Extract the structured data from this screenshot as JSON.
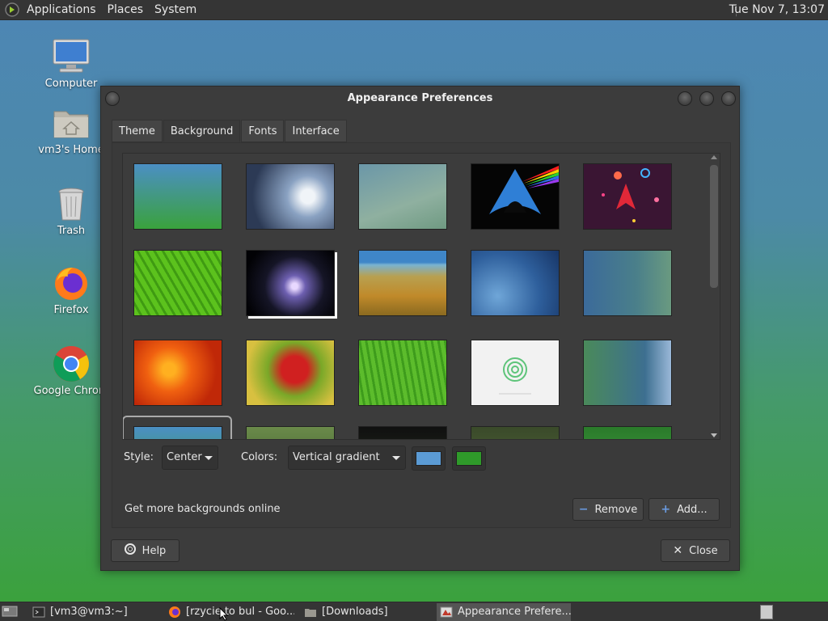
{
  "top_panel": {
    "menus": [
      "Applications",
      "Places",
      "System"
    ],
    "clock": "Tue Nov  7, 13:07"
  },
  "desktop": {
    "icons": [
      {
        "label": "Computer",
        "icon": "computer-icon"
      },
      {
        "label": "vm3's Home",
        "icon": "home-folder-icon"
      },
      {
        "label": "Trash",
        "icon": "trash-icon"
      },
      {
        "label": "Firefox",
        "icon": "firefox-icon"
      },
      {
        "label": "Google Chrom",
        "icon": "chrome-icon"
      }
    ]
  },
  "window": {
    "title": "Appearance Preferences",
    "tabs": [
      {
        "label": "Theme",
        "active": false
      },
      {
        "label": "Background",
        "active": true
      },
      {
        "label": "Fonts",
        "active": false
      },
      {
        "label": "Interface",
        "active": false
      }
    ],
    "style_label": "Style:",
    "style_value": "Center",
    "colors_label": "Colors:",
    "colors_value": "Vertical gradient",
    "color1": "#5b9bd5",
    "color2": "#2f9a2a",
    "get_more_label": "Get more backgrounds online",
    "remove_label": "Remove",
    "add_label": "Add...",
    "help_label": "Help",
    "close_label": "Close"
  },
  "taskbar": {
    "tasks": [
      {
        "label": "[vm3@vm3:~]",
        "icon": "terminal-icon",
        "active": false
      },
      {
        "label": "[rzycie to bul - Goo...",
        "icon": "firefox-icon",
        "active": false
      },
      {
        "label": "[Downloads]",
        "icon": "folder-icon",
        "active": false
      },
      {
        "label": "Appearance Prefere...",
        "icon": "appearance-icon",
        "active": true
      }
    ]
  }
}
